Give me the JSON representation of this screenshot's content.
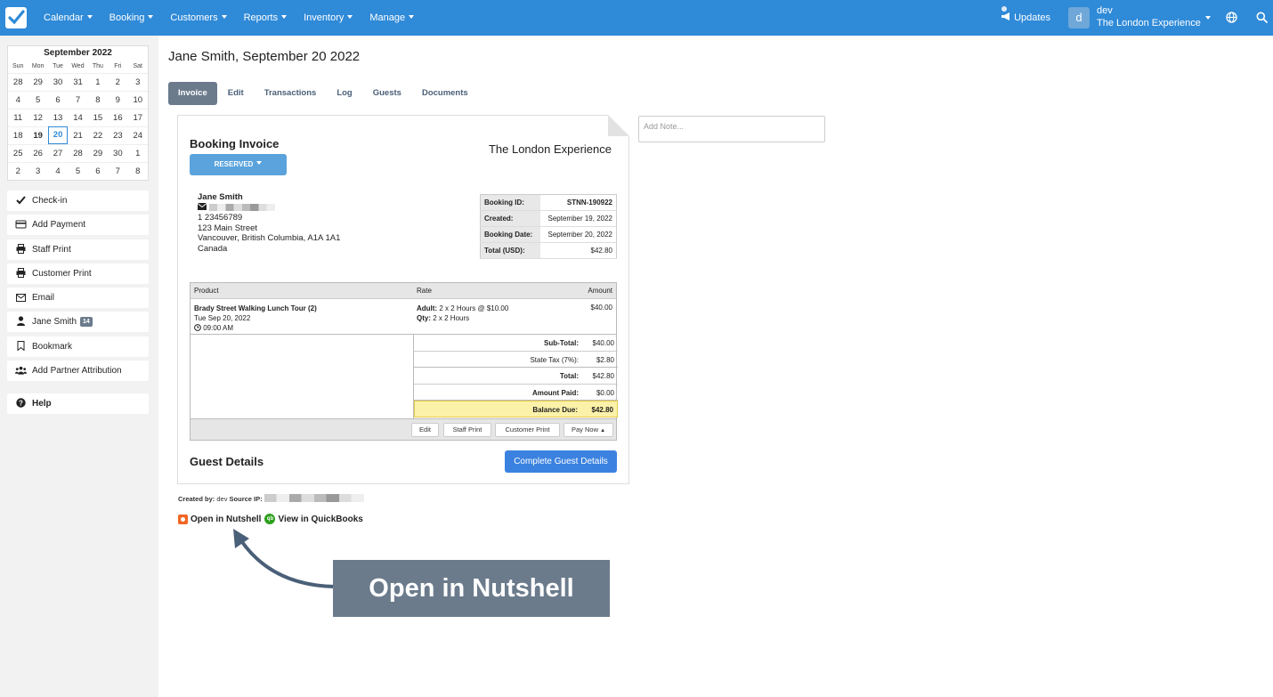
{
  "nav": {
    "items": [
      "Calendar",
      "Booking",
      "Customers",
      "Reports",
      "Inventory",
      "Manage"
    ],
    "updates": "Updates",
    "user_initial": "d",
    "user_name": "dev",
    "user_org": "The London Experience"
  },
  "calendar": {
    "title": "September 2022",
    "weekdays": [
      "Sun",
      "Mon",
      "Tue",
      "Wed",
      "Thu",
      "Fri",
      "Sat"
    ],
    "weeks": [
      [
        "28",
        "29",
        "30",
        "31",
        "1",
        "2",
        "3"
      ],
      [
        "4",
        "5",
        "6",
        "7",
        "8",
        "9",
        "10"
      ],
      [
        "11",
        "12",
        "13",
        "14",
        "15",
        "16",
        "17"
      ],
      [
        "18",
        "19",
        "20",
        "21",
        "22",
        "23",
        "24"
      ],
      [
        "25",
        "26",
        "27",
        "28",
        "29",
        "30",
        "1"
      ],
      [
        "2",
        "3",
        "4",
        "5",
        "6",
        "7",
        "8"
      ]
    ],
    "today": "19",
    "selected": "20"
  },
  "sidebar": {
    "checkin": "Check-in",
    "add_payment": "Add Payment",
    "staff_print": "Staff Print",
    "customer_print": "Customer Print",
    "email": "Email",
    "customer": "Jane Smith",
    "customer_badge": "14",
    "bookmark": "Bookmark",
    "partner": "Add Partner Attribution",
    "help": "Help"
  },
  "page": {
    "title": "Jane Smith, September 20 2022",
    "tabs": [
      "Invoice",
      "Edit",
      "Transactions",
      "Log",
      "Guests",
      "Documents"
    ],
    "active_tab": "Invoice"
  },
  "invoice": {
    "title": "Booking Invoice",
    "status": "RESERVED",
    "company": "The London Experience",
    "customer": {
      "name": "Jane Smith",
      "phone": "1 23456789",
      "street": "123 Main Street",
      "city": "Vancouver, British Columbia, A1A 1A1",
      "country": "Canada"
    },
    "meta": [
      {
        "k": "Booking ID:",
        "v": "STNN-190922"
      },
      {
        "k": "Created:",
        "v": "September 19, 2022"
      },
      {
        "k": "Booking Date:",
        "v": "September 20, 2022"
      },
      {
        "k": "Total (USD):",
        "v": "$42.80"
      }
    ],
    "columns": {
      "product": "Product",
      "rate": "Rate",
      "amount": "Amount"
    },
    "line": {
      "product": "Brady Street Walking Lunch Tour (2)",
      "date": "Tue Sep 20, 2022",
      "time": "09:00 AM",
      "rate_label1": "Adult:",
      "rate_value1": "2 x 2 Hours @ $10.00",
      "rate_label2": "Qty:",
      "rate_value2": "2 x 2 Hours",
      "amount": "$40.00"
    },
    "totals": {
      "subtotal_label": "Sub-Total:",
      "subtotal": "$40.00",
      "tax_label": "State Tax (7%):",
      "tax": "$2.80",
      "total_label": "Total:",
      "total": "$42.80",
      "paid_label": "Amount Paid:",
      "paid": "$0.00",
      "due_label": "Balance Due:",
      "due": "$42.80"
    },
    "buttons": {
      "edit": "Edit",
      "staff_print": "Staff Print",
      "customer_print": "Customer Print",
      "pay_now": "Pay Now"
    },
    "guest_title": "Guest Details",
    "guest_button": "Complete Guest Details"
  },
  "note_placeholder": "Add Note...",
  "created": {
    "label": "Created by:",
    "user": "dev",
    "ip_label": "Source IP:"
  },
  "links": {
    "nutshell": "Open in Nutshell",
    "quickbooks": "View in QuickBooks"
  },
  "callout": "Open in Nutshell",
  "colors": {
    "nav": "#2f8ad8",
    "tab_active": "#6b7b8c",
    "primary_button": "#3b82e0",
    "balance_due": "#fbf1a9"
  }
}
